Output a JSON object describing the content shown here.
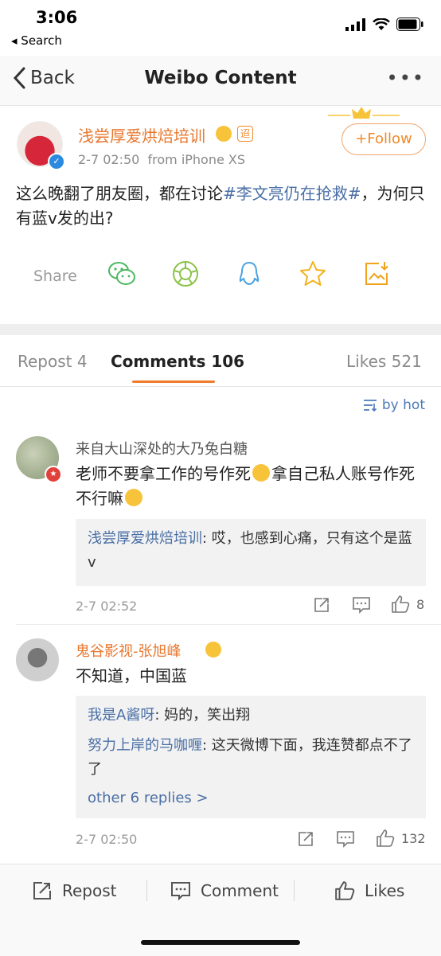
{
  "status_bar": {
    "time": "3:06",
    "back_app": "◂ Search"
  },
  "nav": {
    "back_label": "Back",
    "title": "Weibo Content",
    "more": "•••"
  },
  "post": {
    "author": "浅尝厚爱烘焙培训",
    "vip_badge": "迢",
    "time": "2-7 02:50",
    "source": "from iPhone XS",
    "follow_label": "+Follow",
    "text_before": "这么晚翻了朋友圈，都在讨论",
    "hashtag": "#李文亮仍在抢救#",
    "text_after": "，为何只有蓝v发的出?",
    "share_label": "Share"
  },
  "tabs": {
    "repost": "Repost 4",
    "comments": "Comments 106",
    "likes": "Likes 521",
    "sort_label": "by hot"
  },
  "comments": [
    {
      "author": "来自大山深处的大乃兔白糖",
      "author_color": "#555555",
      "text_a": "老师不要拿工作的号作死",
      "text_b": "拿自己私人账号作死不行嘛",
      "replies": [
        {
          "name": "浅尝厚爱烘焙培训",
          "text": ": 哎，也感到心痛，只有这个是蓝v"
        }
      ],
      "time": "2-7 02:52",
      "likes": "8"
    },
    {
      "author": "鬼谷影视-张旭峰",
      "author_color": "#e8772e",
      "text_a": "不知道，中国蓝",
      "replies": [
        {
          "name": "我是A酱呀",
          "text": ": 妈的，笑出翔"
        },
        {
          "name": "努力上岸的马咖喱",
          "text": ": 这天微博下面，我连赞都点不了了"
        }
      ],
      "more_replies": "other 6 replies >",
      "time": "2-7 02:50",
      "likes": "132"
    }
  ],
  "bottom_bar": {
    "repost": "Repost",
    "comment": "Comment",
    "likes": "Likes"
  },
  "colors": {
    "accent": "#f07b2b",
    "link": "#4a6fa5",
    "orange_name": "#e8772e"
  }
}
